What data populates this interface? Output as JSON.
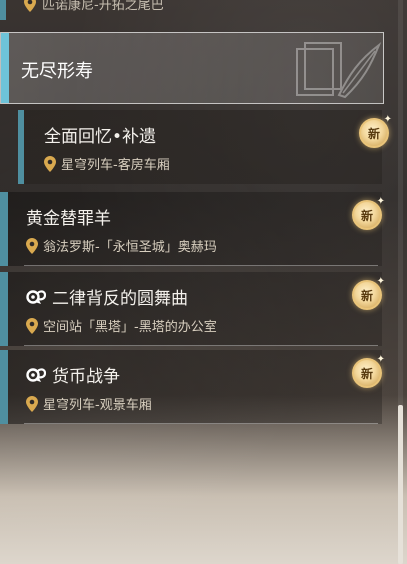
{
  "top_cut_item": {
    "location": "匹诺康尼-开拓之尾巴"
  },
  "category": {
    "title": "无尽形寿",
    "emblem_icon": "feather-book-emblem-icon"
  },
  "quests": [
    {
      "title": "全面回忆•补遗",
      "location": "星穹列车-客房车厢",
      "badge": "新",
      "has_type_icon": false,
      "nested": true
    },
    {
      "title": "黄金替罪羊",
      "location": "翁法罗斯-「永恒圣城」奥赫玛",
      "badge": "新",
      "has_type_icon": false,
      "nested": false
    },
    {
      "title": "二律背反的圆舞曲",
      "location": "空间站「黑塔」-黑塔的办公室",
      "badge": "新",
      "has_type_icon": true,
      "nested": false
    },
    {
      "title": "货币战争",
      "location": "星穹列车-观景车厢",
      "badge": "新",
      "has_type_icon": true,
      "nested": false
    }
  ],
  "colors": {
    "accent": "#4f8fa0",
    "selected_accent": "#6ec3d9",
    "badge_gold": "#e9c47a"
  },
  "scroll": {
    "position_fraction": 0.9
  }
}
